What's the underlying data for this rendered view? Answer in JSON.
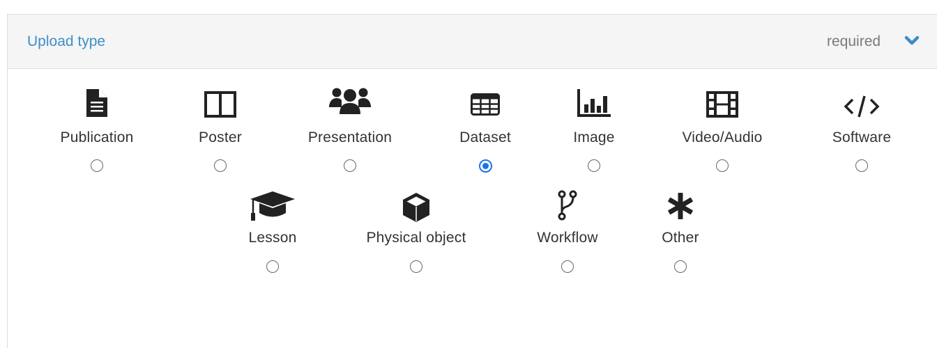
{
  "panel": {
    "title": "Upload type",
    "required_label": "required",
    "colors": {
      "title": "#3d8ec6",
      "chevron": "#3d8ec6",
      "radio_checked": "#1a73e8"
    }
  },
  "upload_types": [
    {
      "label": "Publication",
      "icon": "file-text-icon",
      "selected": false
    },
    {
      "label": "Poster",
      "icon": "columns-icon",
      "selected": false
    },
    {
      "label": "Presentation",
      "icon": "users-icon",
      "selected": false
    },
    {
      "label": "Dataset",
      "icon": "table-icon",
      "selected": true
    },
    {
      "label": "Image",
      "icon": "bar-chart-icon",
      "selected": false
    },
    {
      "label": "Video/Audio",
      "icon": "film-icon",
      "selected": false
    },
    {
      "label": "Software",
      "icon": "code-icon",
      "selected": false
    },
    {
      "label": "Lesson",
      "icon": "graduation-cap-icon",
      "selected": false
    },
    {
      "label": "Physical object",
      "icon": "cube-icon",
      "selected": false
    },
    {
      "label": "Workflow",
      "icon": "code-fork-icon",
      "selected": false
    },
    {
      "label": "Other",
      "icon": "asterisk-icon",
      "selected": false
    }
  ]
}
